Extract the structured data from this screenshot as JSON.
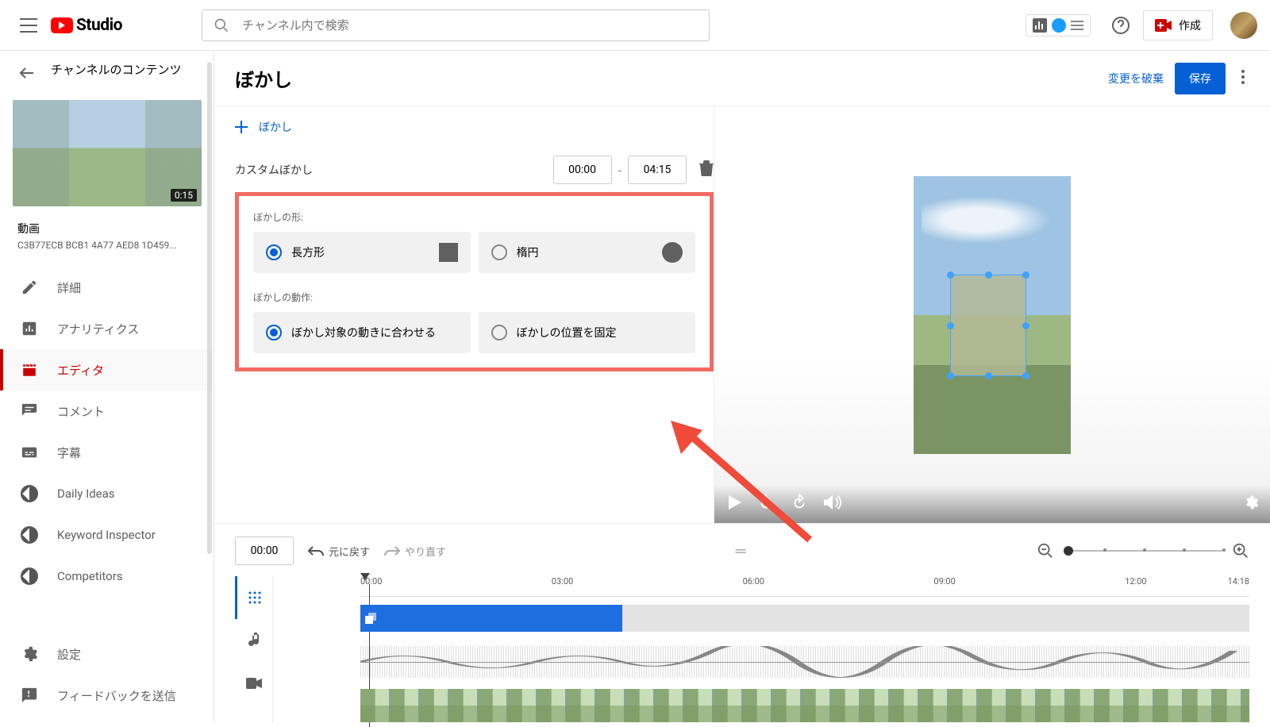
{
  "header": {
    "logo_text": "Studio",
    "search_placeholder": "チャンネル内で検索",
    "create_label": "作成"
  },
  "sidebar": {
    "back_title": "チャンネルのコンテンツ",
    "thumb_duration": "0:15",
    "meta_title": "動画",
    "meta_sub": "C3B77ECB BCB1 4A77 AED8 1D459...",
    "items": [
      {
        "label": "詳細"
      },
      {
        "label": "アナリティクス"
      },
      {
        "label": "エディタ"
      },
      {
        "label": "コメント"
      },
      {
        "label": "字幕"
      },
      {
        "label": "Daily Ideas"
      },
      {
        "label": "Keyword Inspector"
      },
      {
        "label": "Competitors"
      }
    ],
    "footer": {
      "settings": "設定",
      "feedback": "フィードバックを送信"
    }
  },
  "page": {
    "title": "ぼかし",
    "discard": "変更を破棄",
    "save": "保存"
  },
  "blur_panel": {
    "add_label": "ぼかし",
    "custom_label": "カスタムぼかし",
    "time_start": "00:00",
    "time_end": "04:15",
    "shape_label": "ぼかしの形:",
    "shape_rect": "長方形",
    "shape_ellipse": "楕円",
    "behavior_label": "ぼかしの動作:",
    "behavior_track": "ぼかし対象の動きに合わせる",
    "behavior_fixed": "ぼかしの位置を固定"
  },
  "timeline": {
    "current": "00:00",
    "undo": "元に戻す",
    "redo": "やり直す",
    "marks": [
      "00:00",
      "03:00",
      "06:00",
      "09:00",
      "12:00",
      "14:18"
    ]
  }
}
